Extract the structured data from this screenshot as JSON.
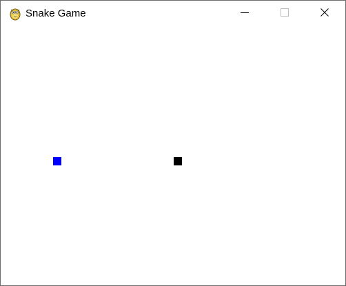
{
  "window": {
    "title": "Snake Game",
    "app_icon": "pygame-snake-icon"
  },
  "title_controls": {
    "minimize_icon": "minimize-icon",
    "maximize_icon": "maximize-icon",
    "close_icon": "close-icon"
  },
  "game": {
    "food": {
      "color": "#0000ff"
    },
    "snake_head": {
      "color": "#000000"
    }
  }
}
